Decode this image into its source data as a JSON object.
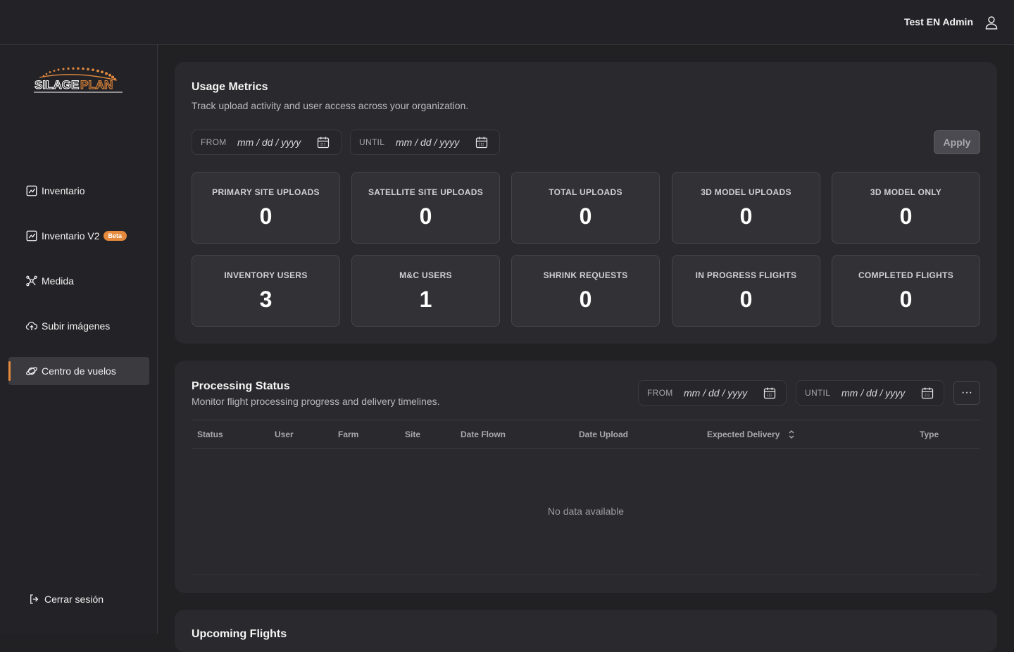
{
  "header": {
    "user_name": "Test EN Admin"
  },
  "sidebar": {
    "logo_text": "SILAGEPLAN",
    "items": [
      {
        "label": "Inventario",
        "icon": "chart-line-icon"
      },
      {
        "label": "Inventario V2",
        "icon": "chart-line-icon",
        "badge": "Beta"
      },
      {
        "label": "Medida",
        "icon": "drone-icon"
      },
      {
        "label": "Subir imágenes",
        "icon": "cloud-upload-icon"
      },
      {
        "label": "Centro de vuelos",
        "icon": "planet-icon",
        "active": true
      }
    ],
    "logout": "Cerrar sesión"
  },
  "usage": {
    "title": "Usage Metrics",
    "subtitle": "Track upload activity and user access across your organization.",
    "from_label": "FROM",
    "until_label": "UNTIL",
    "date_placeholder": "mm / dd / yyyy",
    "apply": "Apply",
    "metrics": [
      {
        "label": "PRIMARY SITE UPLOADS",
        "value": "0"
      },
      {
        "label": "SATELLITE SITE UPLOADS",
        "value": "0"
      },
      {
        "label": "TOTAL UPLOADS",
        "value": "0"
      },
      {
        "label": "3D MODEL UPLOADS",
        "value": "0"
      },
      {
        "label": "3D MODEL ONLY",
        "value": "0"
      },
      {
        "label": "INVENTORY USERS",
        "value": "3"
      },
      {
        "label": "M&C USERS",
        "value": "1"
      },
      {
        "label": "SHRINK REQUESTS",
        "value": "0"
      },
      {
        "label": "IN PROGRESS FLIGHTS",
        "value": "0"
      },
      {
        "label": "COMPLETED FLIGHTS",
        "value": "0"
      }
    ]
  },
  "processing": {
    "title": "Processing Status",
    "subtitle": "Monitor flight processing progress and delivery timelines.",
    "from_label": "FROM",
    "until_label": "UNTIL",
    "date_placeholder": "mm / dd / yyyy",
    "more": "···",
    "columns": [
      "Status",
      "User",
      "Farm",
      "Site",
      "Date Flown",
      "Date Upload",
      "Expected Delivery",
      "Type"
    ],
    "empty": "No data available"
  },
  "upcoming": {
    "title": "Upcoming Flights"
  },
  "colors": {
    "accent": "#e58a3d",
    "background": "#212124",
    "card": "#2a2a2e"
  }
}
